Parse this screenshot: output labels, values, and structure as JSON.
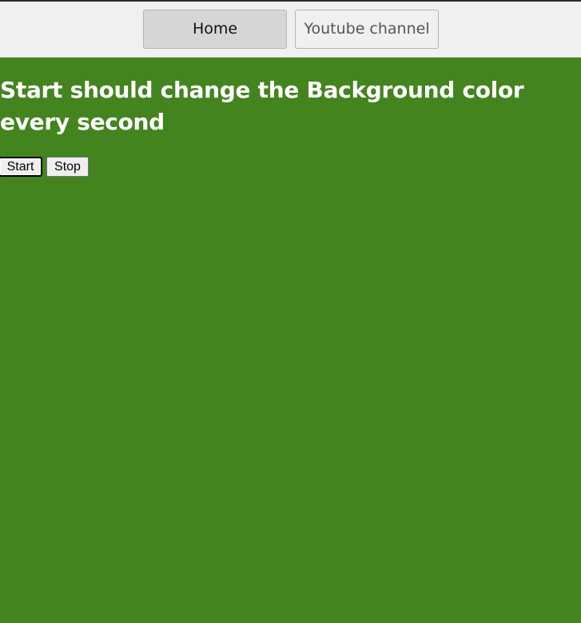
{
  "nav": {
    "home_label": "Home",
    "youtube_label": "Youtube channel"
  },
  "main": {
    "heading": "Start should change the Background color every second",
    "start_label": "Start",
    "stop_label": "Stop"
  },
  "colors": {
    "background": "#43841f",
    "nav_background": "#f0f0f0",
    "heading_text": "#ffffff"
  }
}
